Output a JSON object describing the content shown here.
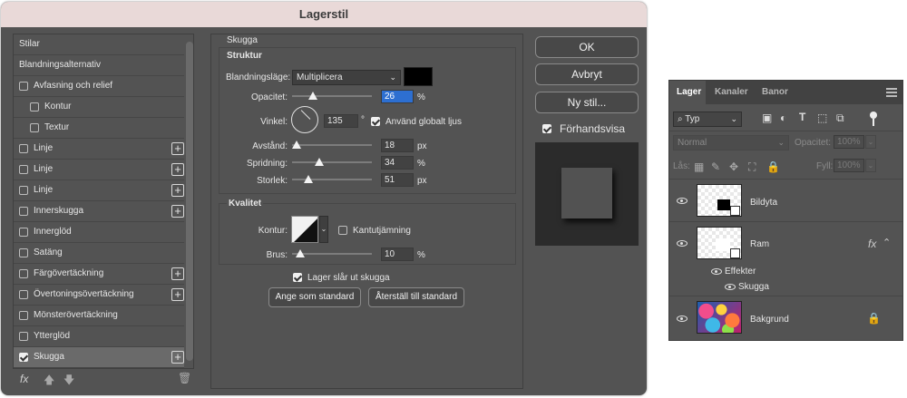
{
  "dialog": {
    "title": "Lagerstil",
    "list": {
      "header_styles": "Stilar",
      "header_blend": "Blandningsalternativ",
      "items": [
        {
          "label": "Avfasning och relief",
          "checked": false,
          "plus": false,
          "indent": false
        },
        {
          "label": "Kontur",
          "checked": false,
          "plus": false,
          "indent": true
        },
        {
          "label": "Textur",
          "checked": false,
          "plus": false,
          "indent": true
        },
        {
          "label": "Linje",
          "checked": false,
          "plus": true,
          "indent": false
        },
        {
          "label": "Linje",
          "checked": false,
          "plus": true,
          "indent": false
        },
        {
          "label": "Linje",
          "checked": false,
          "plus": true,
          "indent": false
        },
        {
          "label": "Innerskugga",
          "checked": false,
          "plus": true,
          "indent": false
        },
        {
          "label": "Innerglöd",
          "checked": false,
          "plus": false,
          "indent": false
        },
        {
          "label": "Satäng",
          "checked": false,
          "plus": false,
          "indent": false
        },
        {
          "label": "Färgövertäckning",
          "checked": false,
          "plus": true,
          "indent": false
        },
        {
          "label": "Övertoningsövertäckning",
          "checked": false,
          "plus": true,
          "indent": false
        },
        {
          "label": "Mönsterövertäckning",
          "checked": false,
          "plus": false,
          "indent": false
        },
        {
          "label": "Ytterglöd",
          "checked": false,
          "plus": false,
          "indent": false
        },
        {
          "label": "Skugga",
          "checked": true,
          "plus": true,
          "indent": false,
          "selected": true
        }
      ],
      "fx": "fx"
    },
    "shadow": {
      "section_title": "Skugga",
      "structure_title": "Struktur",
      "blend_mode_label": "Blandningsläge:",
      "blend_mode_value": "Multiplicera",
      "shadow_color": "#000000",
      "opacity_label": "Opacitet:",
      "opacity_value": "26",
      "opacity_fraction": 0.26,
      "percent": "%",
      "angle_label": "Vinkel:",
      "angle_value": "135",
      "angle_unit": "°",
      "global_light_label": "Använd globalt ljus",
      "distance_label": "Avstånd:",
      "distance_value": "18",
      "distance_fraction": 0.06,
      "px": "px",
      "spread_label": "Spridning:",
      "spread_value": "34",
      "spread_fraction": 0.34,
      "size_label": "Storlek:",
      "size_value": "51",
      "size_fraction": 0.2,
      "quality_title": "Kvalitet",
      "contour_label": "Kontur:",
      "antialias_label": "Kantutjämning",
      "noise_label": "Brus:",
      "noise_value": "10",
      "noise_fraction": 0.1,
      "knockout_label": "Lager slår ut skugga",
      "make_default": "Ange som standard",
      "reset_default": "Återställ till standard"
    },
    "buttons": {
      "ok": "OK",
      "cancel": "Avbryt",
      "new_style": "Ny stil...",
      "preview_label": "Förhandsvisa"
    }
  },
  "layers_panel": {
    "tabs": [
      "Lager",
      "Kanaler",
      "Banor"
    ],
    "filter_label": "Typ",
    "blend_mode": "Normal",
    "opacity_label": "Opacitet:",
    "opacity_value": "100%",
    "lock_label": "Lås:",
    "fill_label": "Fyll:",
    "fill_value": "100%",
    "layers": {
      "bildyta": "Bildyta",
      "ram": "Ram",
      "effects": "Effekter",
      "shadow": "Skugga",
      "background": "Bakgrund"
    },
    "fx": "fx"
  }
}
